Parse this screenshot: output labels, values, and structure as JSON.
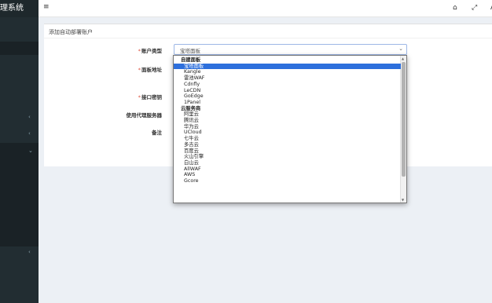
{
  "app": {
    "title": "管理系统"
  },
  "breadcrumb": {
    "title": "添加自动部署账户"
  },
  "form": {
    "account_type_label": "账户类型",
    "panel_url_label": "面板地址",
    "api_key_label": "接口密钥",
    "proxy_label": "使用代理服务器",
    "remark_label": "备注",
    "account_type_value": "宝塔面板"
  },
  "dropdown": {
    "items": [
      {
        "text": "自建面板",
        "group": true
      },
      {
        "text": "宝塔面板",
        "selected": true
      },
      {
        "text": "Kangle"
      },
      {
        "text": "雷池WAF"
      },
      {
        "text": "Cdnfly"
      },
      {
        "text": "LeCDN"
      },
      {
        "text": "GoEdge"
      },
      {
        "text": "1Panel"
      },
      {
        "text": "云服务商",
        "group": true
      },
      {
        "text": "阿里云"
      },
      {
        "text": "腾讯云"
      },
      {
        "text": "华为云"
      },
      {
        "text": "UCloud"
      },
      {
        "text": "七牛云"
      },
      {
        "text": "多吉云"
      },
      {
        "text": "百度云"
      },
      {
        "text": "火山引擎"
      },
      {
        "text": "白山云"
      },
      {
        "text": "AllWAF"
      },
      {
        "text": "AWS"
      },
      {
        "text": "Gcore"
      }
    ]
  },
  "icons": {
    "menu": "hamburger-icon",
    "home": "home-icon",
    "fullscreen": "expand-icon"
  },
  "colors": {
    "sidebar": "#222d32",
    "selected": "#2d6fdc",
    "required": "#dd4b39"
  }
}
